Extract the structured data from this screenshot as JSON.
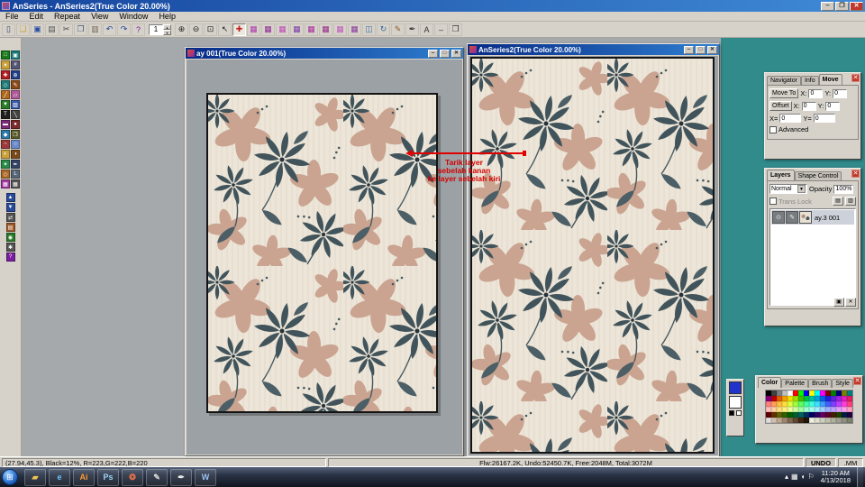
{
  "app": {
    "title": "AnSeries - AnSeries2(True Color 20.00%)",
    "menu_items": [
      "File",
      "Edit",
      "Repeat",
      "View",
      "Window",
      "Help"
    ],
    "zoom_value": "1"
  },
  "toolbar": {
    "group1": [
      {
        "name": "new-icon",
        "glyph": "▯",
        "color": "#334466"
      },
      {
        "name": "open-icon",
        "glyph": "❏",
        "color": "#caa23a"
      },
      {
        "name": "save-icon",
        "glyph": "▣",
        "color": "#2a4fa0"
      },
      {
        "name": "print-icon",
        "glyph": "▤",
        "color": "#555555"
      },
      {
        "name": "cut-icon",
        "glyph": "✂",
        "color": "#444444"
      },
      {
        "name": "copy-icon",
        "glyph": "❐",
        "color": "#445577"
      },
      {
        "name": "paste-icon",
        "glyph": "▥",
        "color": "#776655"
      },
      {
        "name": "undo-icon",
        "glyph": "↶",
        "color": "#1a3fa0"
      },
      {
        "name": "redo-icon",
        "glyph": "↷",
        "color": "#1a3fa0"
      },
      {
        "name": "help-icon",
        "glyph": "?",
        "color": "#7a1fa0"
      }
    ],
    "group2": [
      {
        "name": "zoom-in-icon",
        "glyph": "⊕",
        "color": "#222222"
      },
      {
        "name": "zoom-out-icon",
        "glyph": "⊖",
        "color": "#222222"
      },
      {
        "name": "fit-window-icon",
        "glyph": "⊡",
        "color": "#222222"
      },
      {
        "name": "pointer-tool-icon",
        "glyph": "↖",
        "color": "#222222"
      },
      {
        "name": "move-tool-icon",
        "glyph": "✚",
        "color": "#c02020",
        "active": true
      },
      {
        "name": "repeat-pattern-1-icon",
        "glyph": "▦",
        "color": "#b03ab0"
      },
      {
        "name": "repeat-pattern-2-icon",
        "glyph": "▦",
        "color": "#8e2a96"
      },
      {
        "name": "repeat-pattern-3-icon",
        "glyph": "▦",
        "color": "#c04ab8"
      },
      {
        "name": "repeat-pattern-4-icon",
        "glyph": "▦",
        "color": "#7a3aa8"
      },
      {
        "name": "repeat-pattern-5-icon",
        "glyph": "▦",
        "color": "#a82aa0"
      },
      {
        "name": "repeat-pattern-6-icon",
        "glyph": "▦",
        "color": "#962a8a"
      },
      {
        "name": "repeat-pattern-7-icon",
        "glyph": "▦",
        "color": "#c05ac0"
      },
      {
        "name": "repeat-pattern-8-icon",
        "glyph": "▦",
        "color": "#8a3a9a"
      },
      {
        "name": "mirror-icon",
        "glyph": "◫",
        "color": "#3a6a9a"
      },
      {
        "name": "rotate-icon",
        "glyph": "↻",
        "color": "#3a6a9a"
      },
      {
        "name": "brush-icon",
        "glyph": "✎",
        "color": "#8a5a2a"
      },
      {
        "name": "pen-icon",
        "glyph": "✒",
        "color": "#333333"
      },
      {
        "name": "text-icon",
        "glyph": "A",
        "color": "#333333"
      },
      {
        "name": "child-minimize-icon",
        "glyph": "‒",
        "color": "#333333"
      },
      {
        "name": "child-restore-icon",
        "glyph": "❐",
        "color": "#333333"
      }
    ]
  },
  "palette": {
    "grid_icons": [
      {
        "name": "select-tool-icon",
        "glyph": "□",
        "color": "#1a7a1a"
      },
      {
        "name": "region-tool-icon",
        "glyph": "▣",
        "color": "#1a7a7a"
      },
      {
        "name": "wand-tool-icon",
        "glyph": "✶",
        "color": "#caa23a"
      },
      {
        "name": "crop-tool-icon",
        "glyph": "#",
        "color": "#555577"
      },
      {
        "name": "move-tool-icon",
        "glyph": "✚",
        "color": "#b02020"
      },
      {
        "name": "zoom-tool-icon",
        "glyph": "⊕",
        "color": "#20408a"
      },
      {
        "name": "pan-tool-icon",
        "glyph": "◇",
        "color": "#207a7a"
      },
      {
        "name": "brush-tool-icon",
        "glyph": "✎",
        "color": "#8a4a1a"
      },
      {
        "name": "pencil-tool-icon",
        "glyph": "╱",
        "color": "#b06a20"
      },
      {
        "name": "eraser-tool-icon",
        "glyph": "▱",
        "color": "#b05a9a"
      },
      {
        "name": "fill-tool-icon",
        "glyph": "▼",
        "color": "#2a7a2a"
      },
      {
        "name": "gradient-tool-icon",
        "glyph": "▨",
        "color": "#3a5aaa"
      },
      {
        "name": "text-tool-icon",
        "glyph": "T",
        "color": "#202020"
      },
      {
        "name": "line-tool-icon",
        "glyph": "╲",
        "color": "#444444"
      },
      {
        "name": "rect-tool-icon",
        "glyph": "▬",
        "color": "#7a2a7a"
      },
      {
        "name": "ellipse-tool-icon",
        "glyph": "●",
        "color": "#7a2a2a"
      },
      {
        "name": "polygon-tool-icon",
        "glyph": "◆",
        "color": "#2a7aaa"
      },
      {
        "name": "clone-tool-icon",
        "glyph": "❐",
        "color": "#5a5a2a"
      },
      {
        "name": "smudge-tool-icon",
        "glyph": "~",
        "color": "#9a3a3a"
      },
      {
        "name": "blur-tool-icon",
        "glyph": "○",
        "color": "#6a8aca"
      },
      {
        "name": "dodge-tool-icon",
        "glyph": "◐",
        "color": "#caa23a"
      },
      {
        "name": "burn-tool-icon",
        "glyph": "◑",
        "color": "#7a4a1a"
      },
      {
        "name": "picker-tool-icon",
        "glyph": "✦",
        "color": "#2a8a4a"
      },
      {
        "name": "path-tool-icon",
        "glyph": "✒",
        "color": "#334466"
      },
      {
        "name": "node-tool-icon",
        "glyph": "◇",
        "color": "#aa6a2a"
      },
      {
        "name": "measure-tool-icon",
        "glyph": "L",
        "color": "#556677"
      },
      {
        "name": "repeat-tool-icon",
        "glyph": "▦",
        "color": "#a03aa0"
      },
      {
        "name": "grid-tool-icon",
        "glyph": "▦",
        "color": "#555555"
      }
    ],
    "single_icons": [
      {
        "name": "layer-up-icon",
        "glyph": "▲",
        "color": "#2a4a9a"
      },
      {
        "name": "layer-down-icon",
        "glyph": "▼",
        "color": "#2a4a9a"
      },
      {
        "name": "swap-colors-icon",
        "glyph": "⇄",
        "color": "#555555"
      },
      {
        "name": "palette-icon",
        "glyph": "▤",
        "color": "#a05a2a"
      },
      {
        "name": "preview-icon",
        "glyph": "◉",
        "color": "#2a7a2a"
      },
      {
        "name": "settings-icon",
        "glyph": "✱",
        "color": "#555555"
      },
      {
        "name": "help-tool-icon",
        "glyph": "?",
        "color": "#7a1fa0"
      }
    ]
  },
  "windows": {
    "left": {
      "title": "ay 001(True Color 20.00%)"
    },
    "right": {
      "title": "AnSeries2(True Color 20.00%)"
    }
  },
  "annotation": {
    "lines": [
      "Tarik layer",
      "sebelah kanan",
      "ke layer sebelah kiri"
    ]
  },
  "move_panel": {
    "tabs": [
      {
        "label": "Navigator"
      },
      {
        "label": "Info"
      },
      {
        "label": "Move",
        "active": true
      }
    ],
    "move_to_label": "Move To",
    "offset_label": "Offset",
    "x_label": "X:",
    "y_label": "Y:",
    "x_eq_label": "X=",
    "y_eq_label": "Y=",
    "move_x": "0",
    "move_y": "0",
    "offset_x": "0",
    "offset_y": "0",
    "abs_x": "0",
    "abs_y": "0",
    "advanced_label": "Advanced"
  },
  "layers_panel": {
    "tabs": [
      {
        "label": "Layers",
        "active": true
      },
      {
        "label": "Shape Control"
      }
    ],
    "blend_mode": "Normal",
    "opacity_label": "Opacity",
    "opacity_value": "100%",
    "trans_lock_label": "Trans Lock",
    "layer_name": "ay.3 001"
  },
  "color_panel": {
    "tabs": [
      {
        "label": "Color",
        "active": true
      },
      {
        "label": "Palette"
      },
      {
        "label": "Brush"
      },
      {
        "label": "Style"
      }
    ],
    "swatches": [
      "#000000",
      "#404040",
      "#808080",
      "#c0c0c0",
      "#ffffff",
      "#ff0000",
      "#00ff00",
      "#0000ff",
      "#ffff00",
      "#00ffff",
      "#ff00ff",
      "#800000",
      "#008000",
      "#000080",
      "#808000",
      "#008080",
      "#800080",
      "#c00000",
      "#e06000",
      "#f0a000",
      "#f0e000",
      "#a0e000",
      "#40c000",
      "#00c040",
      "#00c0a0",
      "#00a0e0",
      "#0060e0",
      "#2020e0",
      "#6020e0",
      "#a020e0",
      "#e020c0",
      "#e02060",
      "#ff8080",
      "#ffa060",
      "#ffc040",
      "#ffe040",
      "#e0ff40",
      "#a0ff40",
      "#60ff60",
      "#40ffa0",
      "#40ffe0",
      "#40e0ff",
      "#40a0ff",
      "#4060ff",
      "#8040ff",
      "#c040ff",
      "#ff40e0",
      "#ff4080",
      "#ffc0c0",
      "#ffd0a0",
      "#ffe080",
      "#fff080",
      "#f0ffa0",
      "#d0ffa0",
      "#a0ffa0",
      "#a0ffd0",
      "#a0fff0",
      "#a0f0ff",
      "#a0d0ff",
      "#a0b0ff",
      "#c0a0ff",
      "#e0a0ff",
      "#ffa0f0",
      "#ffa0c0",
      "#600000",
      "#603000",
      "#606000",
      "#306000",
      "#006000",
      "#006030",
      "#006060",
      "#003060",
      "#000060",
      "#300060",
      "#600060",
      "#600030",
      "#402000",
      "#204000",
      "#002040",
      "#200040",
      "#e0e0e0",
      "#d0c0b0",
      "#c0a890",
      "#a08870",
      "#806850",
      "#604830",
      "#402810",
      "#201408",
      "#f0f0e0",
      "#e0e0d0",
      "#d0d0c0",
      "#c0c0b0",
      "#b0b0a0",
      "#a0a090",
      "#909080",
      "#808070"
    ]
  },
  "fgbg": {
    "foreground": "#2233cc",
    "background": "#ffffff"
  },
  "status_bar": {
    "coords": "(27.94,45.3),  Black=12%,  R=223,G=222,B=220",
    "memory": "Flw:26167.2K, Undo:52450.7K, Free:2048M, Total:3072M",
    "undo_label": "UNDO",
    "unit_label": ".MM"
  },
  "taskbar": {
    "icons": [
      {
        "name": "explorer-icon",
        "glyph": "▰",
        "fg": "#f0c552"
      },
      {
        "name": "internet-explorer-icon",
        "glyph": "e",
        "fg": "#6cc0f7"
      },
      {
        "name": "illustrator-icon",
        "glyph": "Ai",
        "fg": "#ff9a33"
      },
      {
        "name": "photoshop-icon",
        "glyph": "Ps",
        "fg": "#9cd4f7"
      },
      {
        "name": "chrome-icon",
        "glyph": "❂",
        "fg": "#e8704a"
      },
      {
        "name": "paint-app-icon",
        "glyph": "✎",
        "fg": "#d8d8d8"
      },
      {
        "name": "pen-app-icon",
        "glyph": "✒",
        "fg": "#f0f0f0"
      },
      {
        "name": "word-icon",
        "glyph": "W",
        "fg": "#9cc3f5"
      }
    ],
    "tray_icons": [
      {
        "name": "hidden-icons-icon",
        "glyph": "▴"
      },
      {
        "name": "display-icon",
        "glyph": "▦"
      },
      {
        "name": "volume-icon",
        "glyph": "◖"
      },
      {
        "name": "network-icon",
        "glyph": "⚐"
      }
    ],
    "time": "11:20 AM",
    "date": "4/13/2018"
  }
}
